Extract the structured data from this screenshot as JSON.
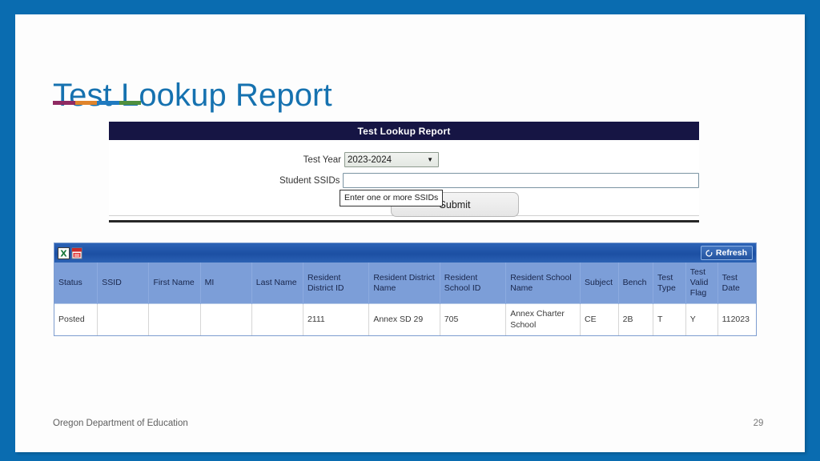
{
  "slide": {
    "title": "Test Lookup Report",
    "accent_bar_colors": [
      "#8f2a62",
      "#e0842c",
      "#1f7ac0",
      "#4f8f3e"
    ],
    "title_color": "#1672b0",
    "frame_color": "#0a6cb0"
  },
  "form_panel": {
    "header_title": "Test Lookup Report",
    "test_year": {
      "label": "Test Year",
      "value": "2023-2024",
      "caret_icon": "chevron-down-icon"
    },
    "student_ssids": {
      "label": "Student SSIDs",
      "value": "",
      "placeholder": ""
    },
    "tooltip_text": "Enter one or more SSIDs",
    "submit_label": "Submit"
  },
  "grid": {
    "toolbar": {
      "excel_icon": "excel-export-icon",
      "pdf_icon": "pdf-export-icon",
      "refresh_label": "Refresh",
      "refresh_icon": "refresh-icon"
    },
    "columns": [
      "Status",
      "SSID",
      "First Name",
      "MI",
      "Last Name",
      "Resident District ID",
      "Resident District Name",
      "Resident School ID",
      "Resident School Name",
      "Subject",
      "Bench",
      "Test Type",
      "Test Valid Flag",
      "Test Date"
    ],
    "rows": [
      {
        "cells": [
          "Posted",
          "",
          "",
          "",
          "",
          "2111",
          "Annex SD 29",
          "705",
          "Annex Charter School",
          "CE",
          "2B",
          "T",
          "Y",
          "112023"
        ]
      }
    ]
  },
  "footer": {
    "organization": "Oregon Department of Education",
    "page_number": "29"
  }
}
